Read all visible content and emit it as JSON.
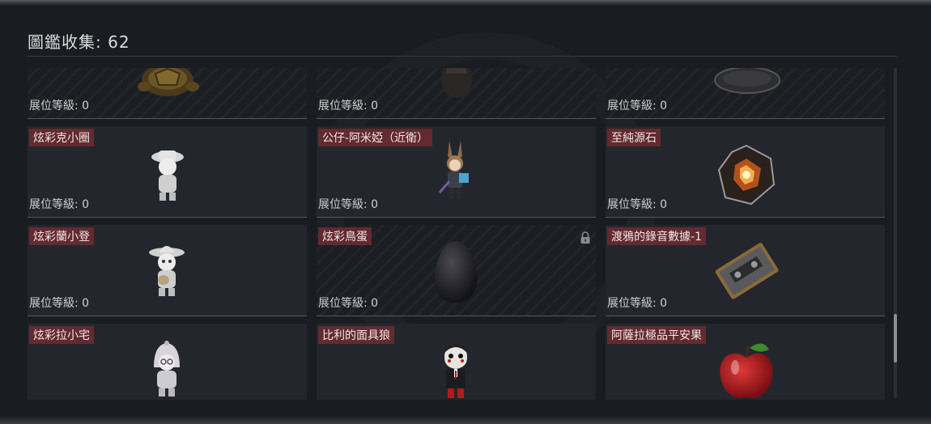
{
  "header": {
    "title": "圖鑑收集: 62"
  },
  "collection": {
    "top_row": [
      {
        "level": "展位等級: 0",
        "icon": "turtle-icon"
      },
      {
        "level": "展位等級: 0",
        "icon": "vase-icon"
      },
      {
        "level": "展位等級: 0",
        "icon": "disc-icon"
      }
    ],
    "items": [
      {
        "name": "炫彩克小圈",
        "level": "展位等級: 0",
        "icon": "figure-hat-icon"
      },
      {
        "name": "公仔-阿米婭（近衛）",
        "level": "展位等級: 0",
        "icon": "figure-amiya-icon"
      },
      {
        "name": "至純源石",
        "level": "展位等級: 0",
        "icon": "crystal-icon"
      },
      {
        "name": "炫彩蘭小登",
        "level": "展位等級: 0",
        "icon": "figure-sombrero-icon"
      },
      {
        "name": "炫彩鳥蛋",
        "level": "展位等級: 0",
        "icon": "egg-icon",
        "locked": true
      },
      {
        "name": "渡鴉的錄音數據-1",
        "level": "展位等級: 0",
        "icon": "cassette-icon"
      },
      {
        "name": "炫彩拉小宅",
        "icon": "figure-hood-icon"
      },
      {
        "name": "比利的面具狼",
        "icon": "puppet-icon"
      },
      {
        "name": "阿薩拉極品平安果",
        "icon": "apple-icon"
      }
    ]
  }
}
